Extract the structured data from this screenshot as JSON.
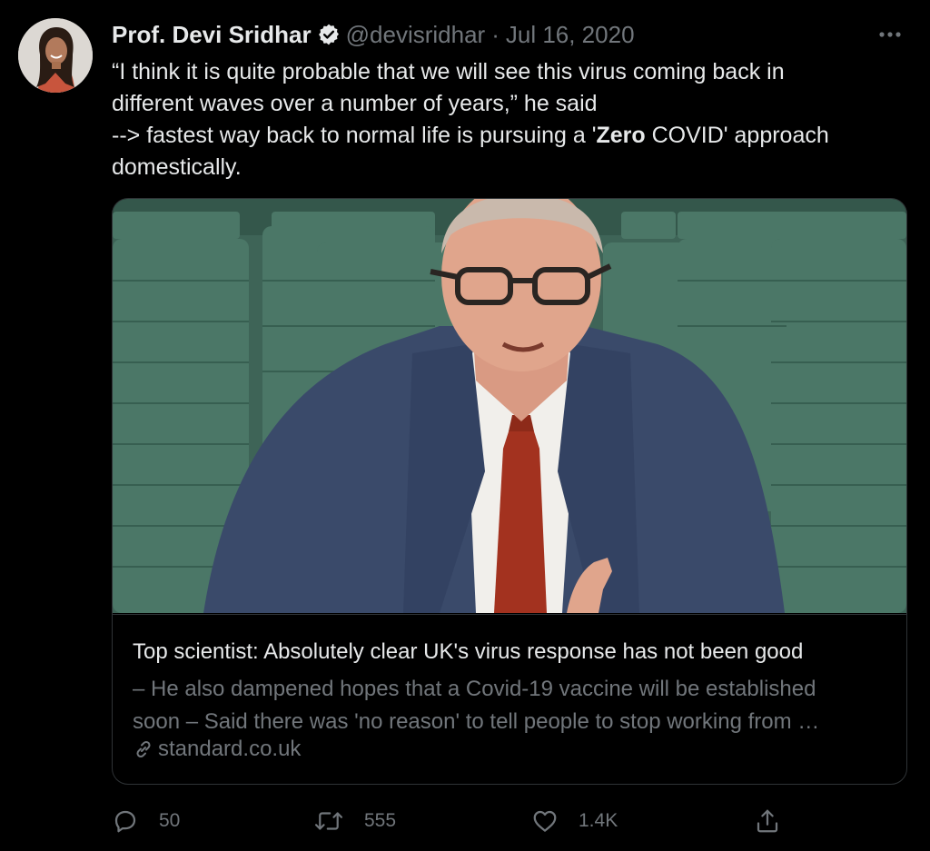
{
  "author": {
    "name": "Prof. Devi Sridhar",
    "handle": "@devisridhar",
    "separator": "·",
    "date": "Jul 16, 2020"
  },
  "tweet": {
    "line1": "“I think it is quite probable that we will see this virus coming back in different waves over a number of years,” he said",
    "line2_pre": "--> fastest way back to normal life is pursuing a '",
    "line2_bold": "Zero",
    "line2_post": " COVID' approach domestically."
  },
  "card": {
    "title": "Top scientist: Absolutely clear UK's virus response has not been good",
    "description_line1": "– He also dampened hopes that a Covid-19 vaccine will be established",
    "description_line2": "soon – Said there was 'no reason' to tell people to stop working from …",
    "domain": "standard.co.uk"
  },
  "actions": {
    "replies": "50",
    "retweets": "555",
    "likes": "1.4K"
  },
  "icons": {
    "verified": "verified-badge-icon",
    "more": "more-icon",
    "link": "link-icon",
    "reply": "reply-icon",
    "retweet": "retweet-icon",
    "like": "heart-icon",
    "share": "share-icon"
  },
  "colors": {
    "background": "#000000",
    "text": "#e7e9ea",
    "muted": "#71767b",
    "border": "#2f3336"
  }
}
